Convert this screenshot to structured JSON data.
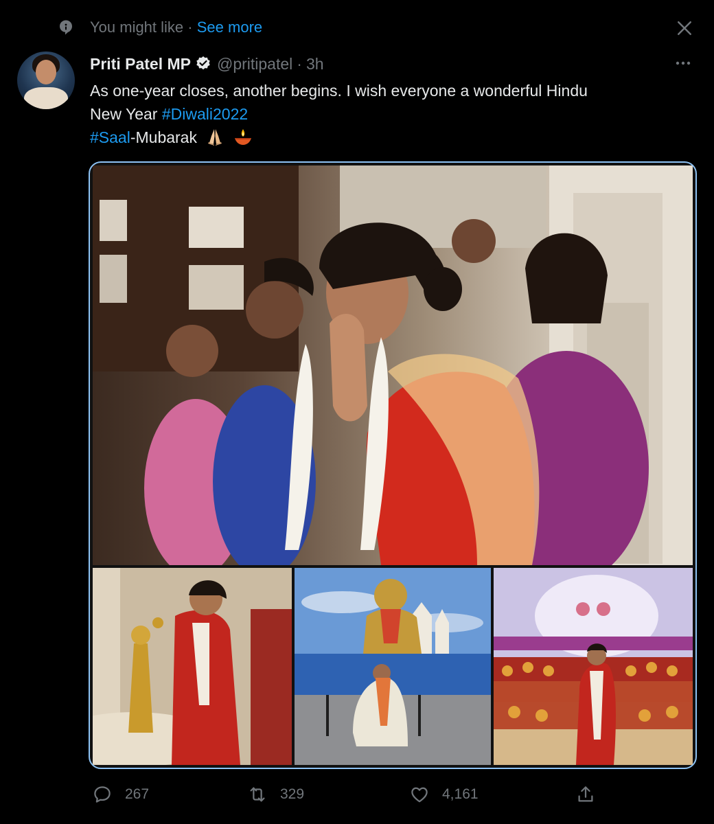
{
  "context": {
    "label": "You might like",
    "separator": "·",
    "link": "See more"
  },
  "tweet": {
    "author_name": "Priti Patel MP",
    "handle": "@pritipatel",
    "separator": "·",
    "time": "3h",
    "text_line1": "As one-year closes, another begins.  I wish everyone a wonderful Hindu",
    "text_line2_prefix": "New Year ",
    "hashtag_diwali": "#Diwali2022",
    "hashtag_saal": "#Saal",
    "text_line3_suffix": "-Mubarak"
  },
  "actions": {
    "replies": "267",
    "retweets": "329",
    "likes": "4,161"
  },
  "colors": {
    "background": "#000000",
    "text_primary": "#e7e9ea",
    "text_secondary": "#71767b",
    "accent": "#1d9bf0",
    "media_focus_border": "#8ec3f5"
  },
  "icons": [
    "topic-icon",
    "close-icon",
    "verified-badge-icon",
    "more-icon",
    "reply-icon",
    "retweet-icon",
    "like-icon",
    "share-icon"
  ]
}
